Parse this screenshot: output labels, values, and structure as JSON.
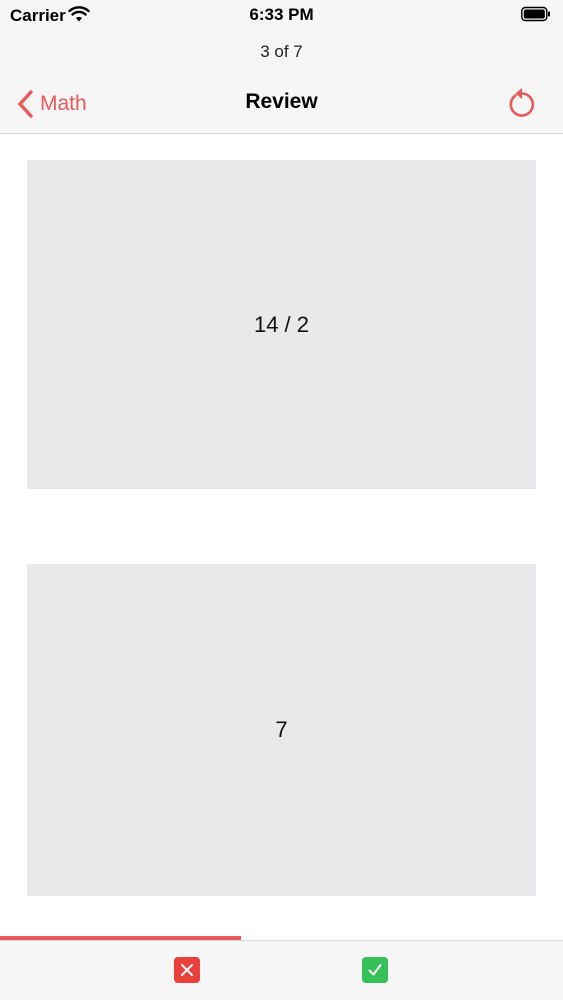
{
  "status_bar": {
    "carrier": "Carrier",
    "time": "6:33 PM"
  },
  "header": {
    "progress": "3 of 7",
    "back_label": "Math",
    "title": "Review"
  },
  "card": {
    "front": "14 / 2",
    "back": "7"
  },
  "progress": {
    "current": 3,
    "total": 7,
    "fraction": 0.4286
  },
  "colors": {
    "accent": "#e9585a",
    "wrong": "#e8403b",
    "right": "#36c05a",
    "card_bg": "#e9e8ea"
  },
  "icons": {
    "back": "chevron-left-icon",
    "reset": "restart-icon",
    "wrong": "x-mark-icon",
    "right": "checkmark-icon"
  }
}
